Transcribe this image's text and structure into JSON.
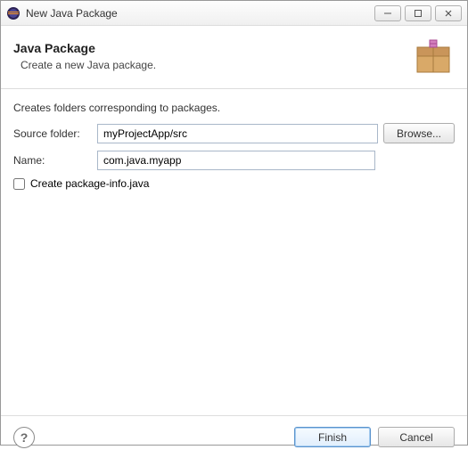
{
  "window": {
    "title": "New Java Package"
  },
  "header": {
    "title": "Java Package",
    "subtitle": "Create a new Java package."
  },
  "content": {
    "description": "Creates folders corresponding to packages.",
    "sourceFolderLabel": "Source folder:",
    "sourceFolderValue": "myProjectApp/src",
    "browseLabel": "Browse...",
    "nameLabel": "Name:",
    "nameValue": "com.java.myapp",
    "createPackageInfoLabel": "Create package-info.java"
  },
  "buttons": {
    "finish": "Finish",
    "cancel": "Cancel"
  }
}
